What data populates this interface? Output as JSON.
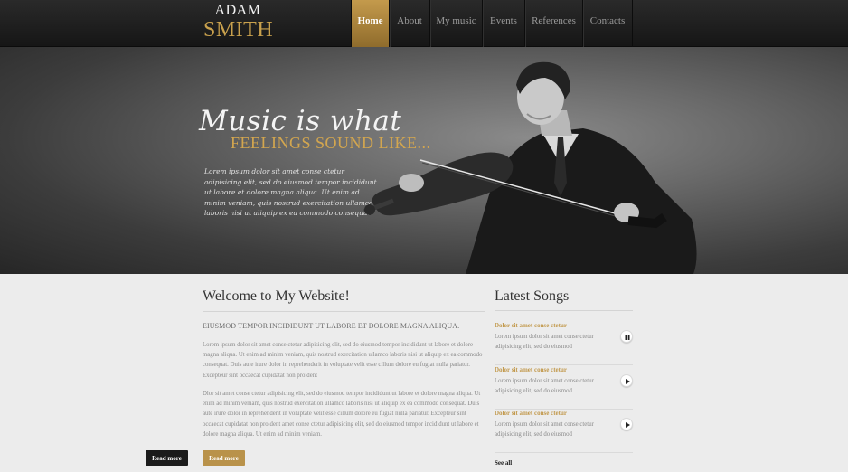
{
  "header": {
    "logo_line1": "ADAM",
    "logo_line2": "SMITH",
    "nav": [
      {
        "label": "Home",
        "active": true
      },
      {
        "label": "About",
        "active": false
      },
      {
        "label": "My music",
        "active": false
      },
      {
        "label": "Events",
        "active": false
      },
      {
        "label": "References",
        "active": false
      },
      {
        "label": "Contacts",
        "active": false
      }
    ]
  },
  "hero": {
    "title_script": "Music is what",
    "title_caps": "FEELINGS SOUND LIKE...",
    "text": "Lorem ipsum dolor sit amet conse ctetur adipisicing elit, sed do eiusmod tempor incididunt ut labore et dolore magna aliqua. Ut enim ad minim veniam, quis nostrud exercitation ullamco laboris nisi ut aliquip ex ea commodo consequat."
  },
  "welcome": {
    "title": "Welcome to My Website!",
    "subhead": "EIUSMOD TEMPOR INCIDIDUNT UT LABORE ET DOLORE MAGNA ALIQUA.",
    "para1": "Lorem ipsum dolor sit amet conse ctetur adipisicing elit, sed do eiusmod tempor incididunt ut labore et dolore magna aliqua. Ut enim ad minim veniam, quis nostrud exercitation ullamco laboris nisi ut aliquip ex ea commodo consequat. Duis aute irure dolor in reprehenderit in voluptate velit esse cillum dolore eu fugiat nulla pariatur. Excepteur sint occaecat cupidatat non proident",
    "para2": "Dlor sit amet conse ctetur adipisicing elit, sed do eiusmod tempor incididunt ut labore et dolore magna aliqua. Ut enim ad minim veniam, quis nostrud exercitation ullamco laboris nisi ut aliquip ex ea commodo consequat. Duis aute irure dolor in reprehenderit in voluptate velit esse cillum dolore eu fugiat nulla pariatur. Excepteur sint occaecat cupidatat non proident amet conse ctetur adipisicing elit, sed do eiusmod tempor incididunt ut labore et dolore magna aliqua. Ut enim ad minim veniam.",
    "btn_dark": "Read more",
    "btn_gold": "Read more"
  },
  "songs": {
    "title": "Latest Songs",
    "items": [
      {
        "title": "Dolor sit amet conse ctetur",
        "desc": "Lorem ipsum dolor sit amet conse ctetur adipisicing elit, sed do eiusmod",
        "state": "pause",
        "icon": "pause-icon"
      },
      {
        "title": "Dolor sit amet conse ctetur",
        "desc": "Lorem ipsum dolor sit amet conse ctetur adipisicing elit, sed do eiusmod",
        "state": "play",
        "icon": "play-icon"
      },
      {
        "title": "Dolor sit amet conse ctetur",
        "desc": "Lorem ipsum dolor sit amet conse ctetur adipisicing elit, sed do eiusmod",
        "state": "play",
        "icon": "play-icon"
      }
    ],
    "see_all": "See all"
  },
  "colors": {
    "accent_gold": "#c49a4c",
    "header_dark": "#1c1c1c",
    "background": "#ececec"
  }
}
